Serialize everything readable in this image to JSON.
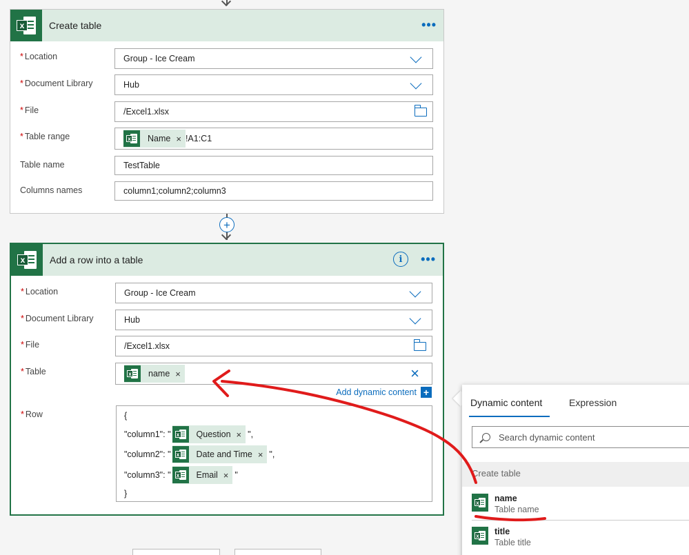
{
  "create_table": {
    "title": "Create table",
    "more_label": "•••",
    "fields": {
      "location": {
        "label": "Location",
        "value": "Group - Ice Cream"
      },
      "document_library": {
        "label": "Document Library",
        "value": "Hub"
      },
      "file": {
        "label": "File",
        "value": "/Excel1.xlsx"
      },
      "table_range": {
        "label": "Table range",
        "token": "Name",
        "suffix": "!A1:C1"
      },
      "table_name": {
        "label": "Table name",
        "value": "TestTable"
      },
      "columns_names": {
        "label": "Columns names",
        "value": "column1;column2;column3"
      }
    }
  },
  "add_row": {
    "title": "Add a row into a table",
    "info_label": "i",
    "more_label": "•••",
    "fields": {
      "location": {
        "label": "Location",
        "value": "Group - Ice Cream"
      },
      "document_library": {
        "label": "Document Library",
        "value": "Hub"
      },
      "file": {
        "label": "File",
        "value": "/Excel1.xlsx"
      },
      "table": {
        "label": "Table",
        "token": "name"
      },
      "row": {
        "label": "Row",
        "open_brace": "{",
        "close_brace": "}",
        "lines": [
          {
            "key": "\"column1\": \"",
            "token": "Question",
            "end": "\","
          },
          {
            "key": "\"column2\": \"",
            "token": "Date and Time",
            "end": "\","
          },
          {
            "key": "\"column3\": \"",
            "token": "Email",
            "end": "\""
          }
        ]
      }
    },
    "add_dynamic_content": "Add dynamic content"
  },
  "required_marker": "*",
  "token_close": "×",
  "excel_letter": "x",
  "plus_label": "+",
  "dynamic_panel": {
    "tabs": [
      "Dynamic content",
      "Expression"
    ],
    "selected_tab": "Dynamic content",
    "search_placeholder": "Search dynamic content",
    "section_title": "Create table",
    "items": [
      {
        "name": "name",
        "description": "Table name"
      },
      {
        "name": "title",
        "description": "Table title"
      }
    ]
  },
  "colors": {
    "excel_green": "#217346",
    "header_tint": "#dcebe2",
    "accent_blue": "#0b6cbd",
    "annotation_red": "#e01b1b"
  }
}
